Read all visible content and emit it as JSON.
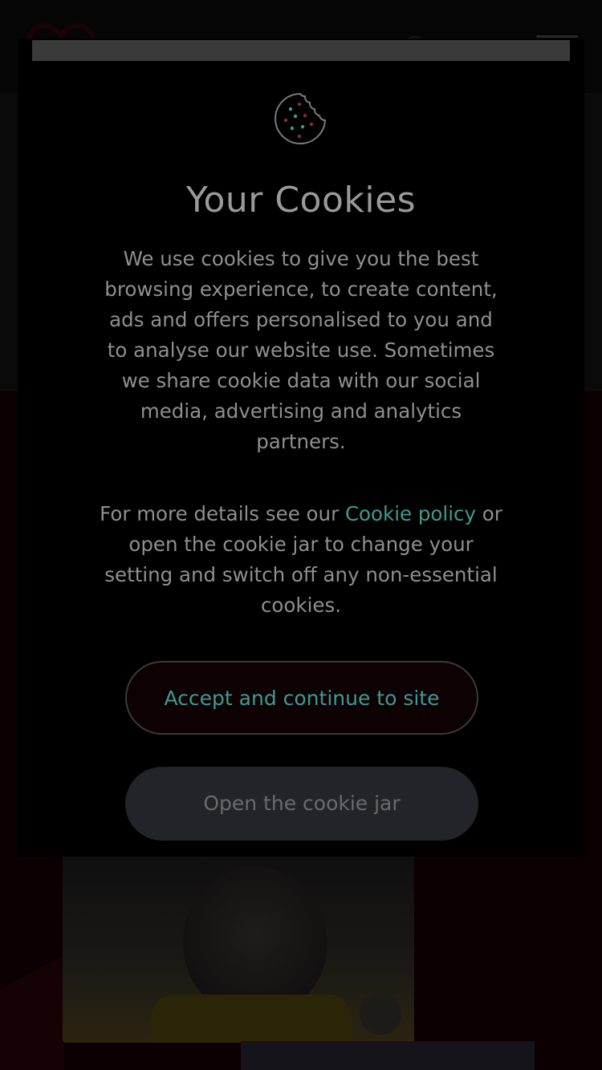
{
  "modal": {
    "title": "Your Cookies",
    "paragraph1": "We use cookies to give you the best browsing experience, to create content, ads and offers personalised to you and to analyse our website use. Sometimes we share cookie data with our social media, advertising and analytics partners.",
    "paragraph2_before": "For more details see our ",
    "paragraph2_link": "Cookie policy",
    "paragraph2_after": " or open the cookie jar to change your setting and switch off any non-essential cookies.",
    "accept_button": "Accept and continue to site",
    "jar_button": "Open the cookie jar"
  },
  "icons": {
    "cookie": "cookie-icon",
    "search": "search-icon",
    "basket": "basket-icon",
    "menu": "hamburger-menu-icon",
    "logo": "heart-logo-icon"
  },
  "colors": {
    "overlay": "#000000",
    "title_text": "#9a9a9a",
    "body_text": "#8f8f8f",
    "link": "#3f9a92",
    "accept_bg": "#0d0104",
    "jar_bg": "#23242a"
  }
}
